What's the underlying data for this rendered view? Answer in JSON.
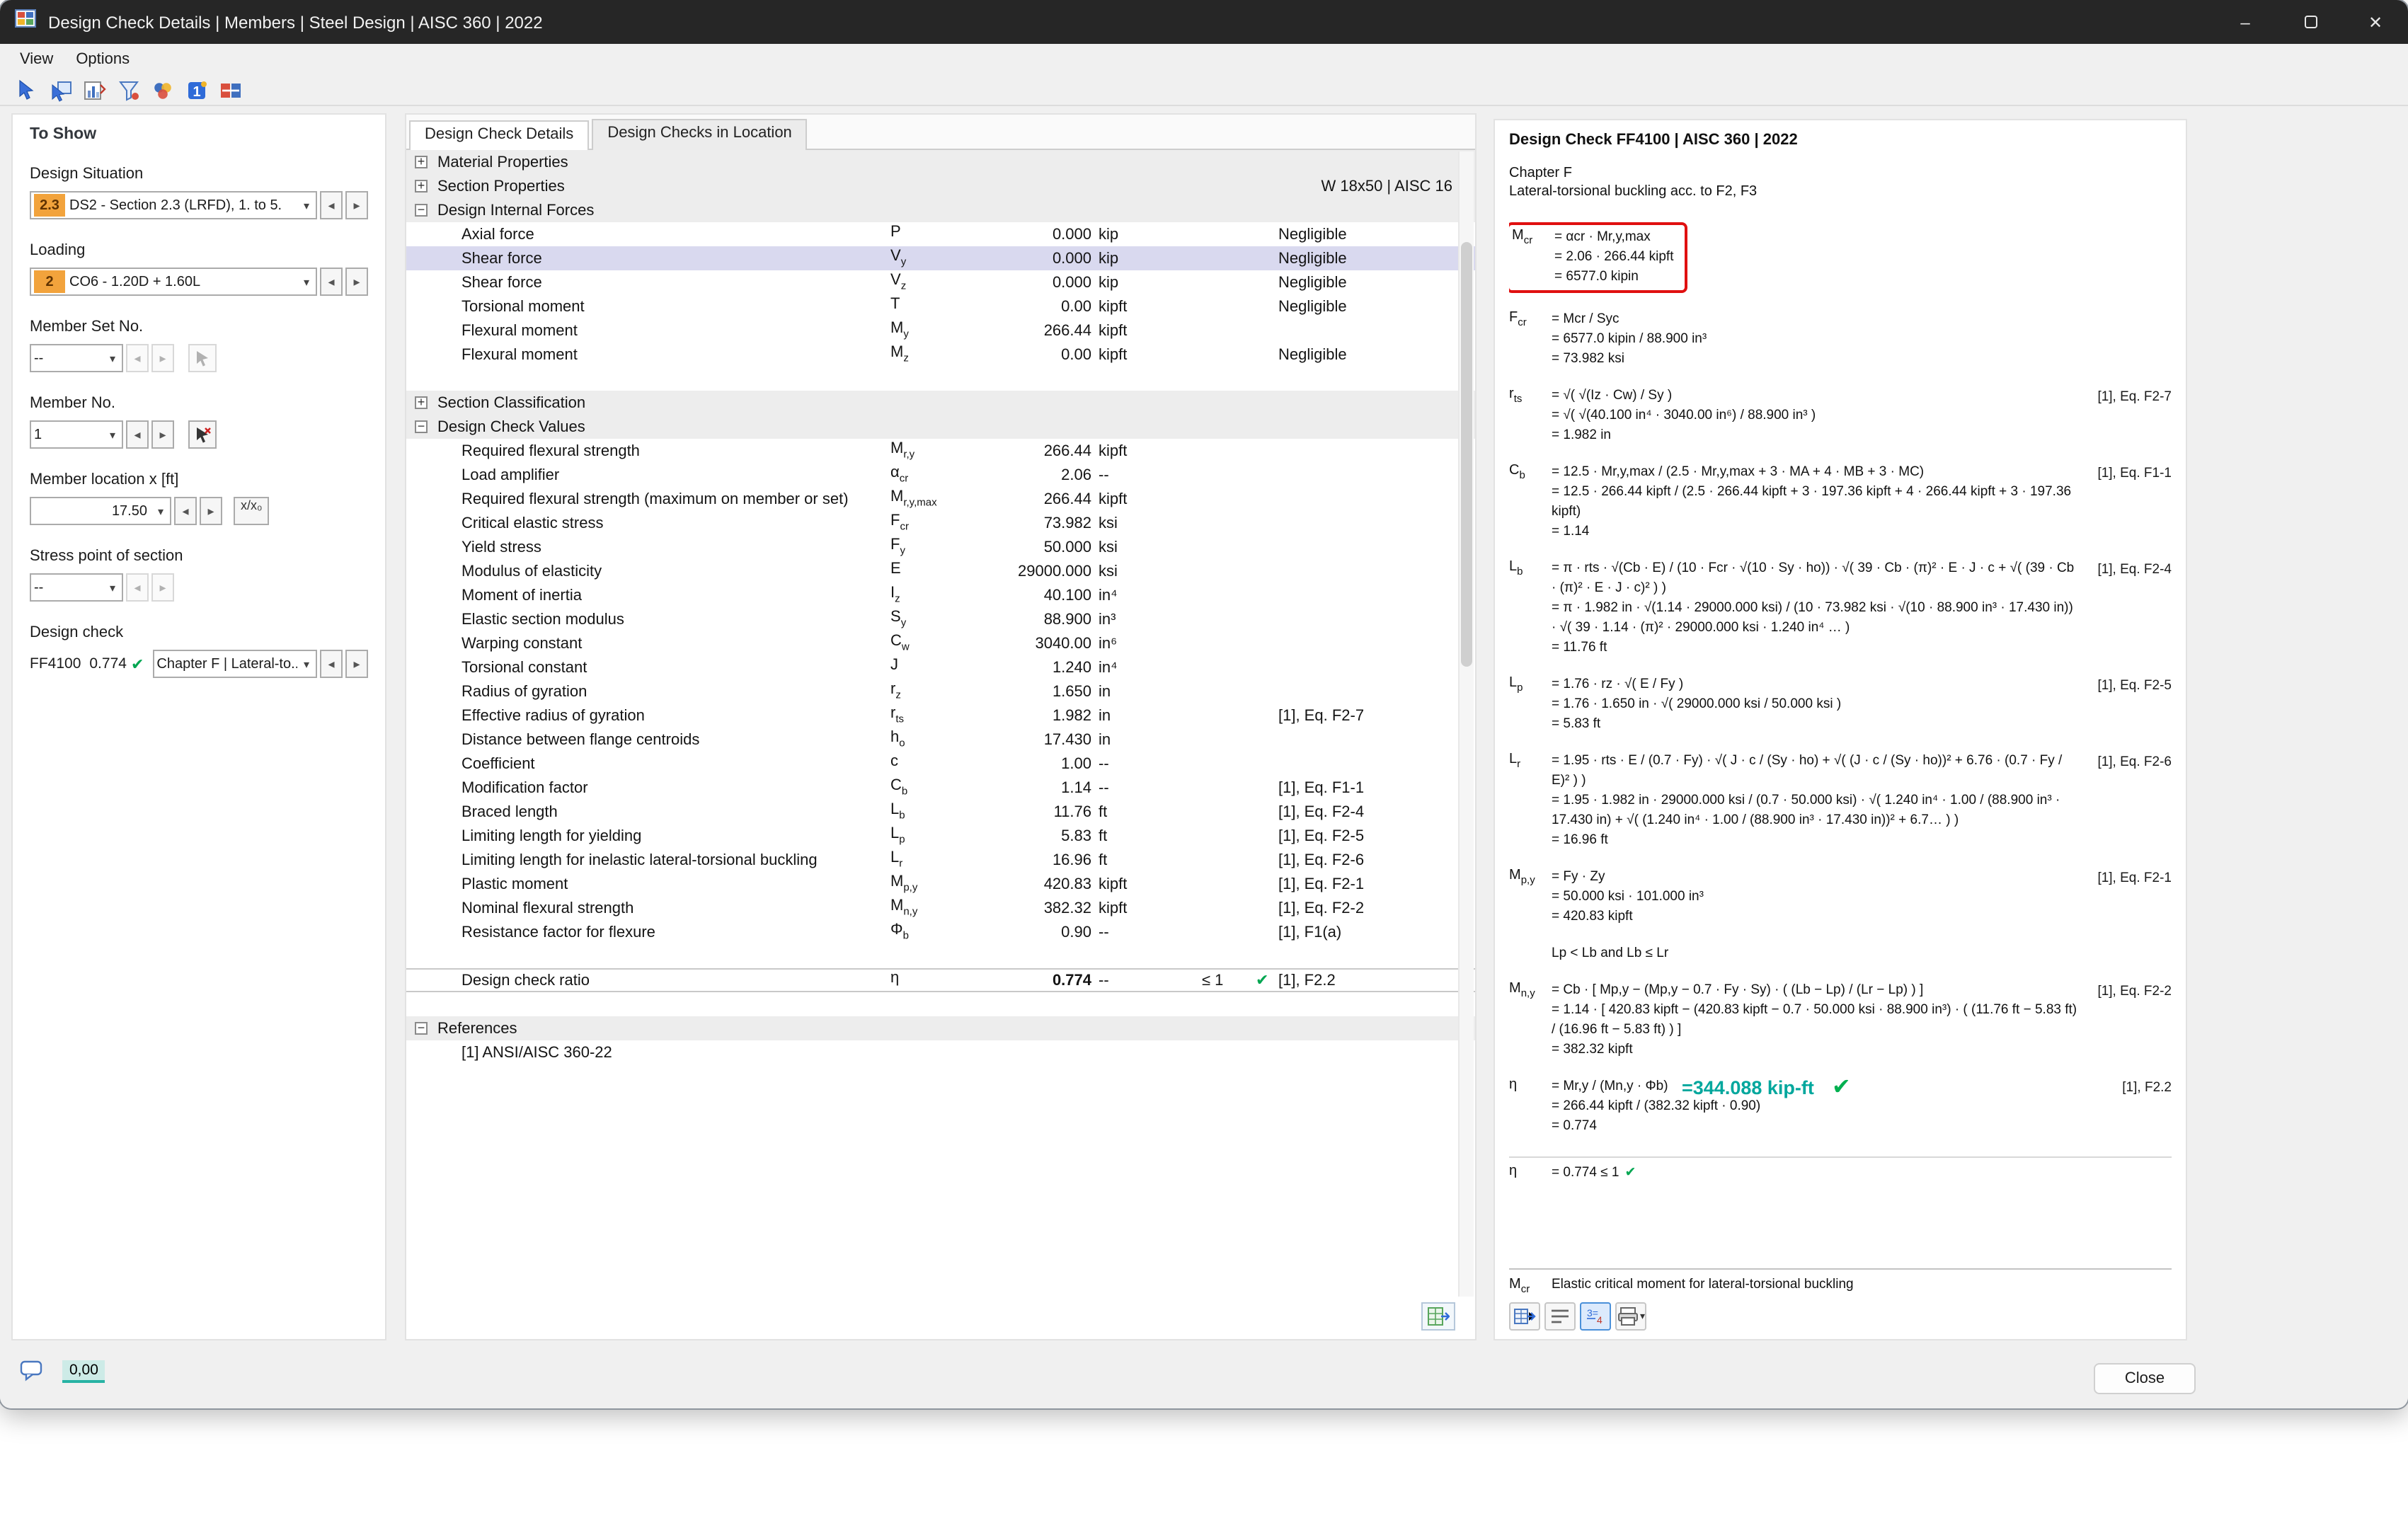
{
  "window": {
    "title": "Design Check Details | Members | Steel Design | AISC 360 | 2022",
    "minimize": "–",
    "close": "✕"
  },
  "menubar": {
    "view": "View",
    "options": "Options"
  },
  "icons": {
    "titlebar": [
      "app-icon",
      "minimize-icon",
      "maximize-icon",
      "close-icon"
    ],
    "toolbar": [
      "select-arrow-icon",
      "select-window-icon",
      "result-diagram-icon",
      "filter-icon",
      "color-scheme-icon",
      "object-info-icon",
      "units-icon"
    ],
    "right_toolbar": [
      "transfer-results-icon",
      "formula-list-icon",
      "show-values-icon",
      "print-icon"
    ],
    "misc": [
      "comment-bubble-icon",
      "send-to-table-icon",
      "pick-member-icon",
      "check-icon",
      "dropdown-caret-icon",
      "tree-expander-icon"
    ]
  },
  "colors": {
    "badge_orange": "#F2A33C",
    "row_highlight": "#D9D9EF",
    "check_green": "#00A651",
    "result_teal": "#00A79D",
    "error_red": "#E01010"
  },
  "to_show": {
    "title": "To Show",
    "design_situation_label": "Design Situation",
    "design_situation_badge": "2.3",
    "design_situation_value": "DS2 - Section 2.3 (LRFD), 1. to 5.",
    "loading_label": "Loading",
    "loading_badge": "2",
    "loading_value": "CO6 - 1.20D + 1.60L",
    "member_set_label": "Member Set No.",
    "member_set_value": "--",
    "member_no_label": "Member No.",
    "member_no_value": "1",
    "member_location_label": "Member location x [ft]",
    "member_location_value": "17.50",
    "xg_button": "x/x₀",
    "stress_point_label": "Stress point of section",
    "stress_point_value": "--",
    "design_check_label": "Design check",
    "design_check_id": "FF4100",
    "design_check_ratio": "0.774",
    "design_check_check": "✔",
    "design_check_value": "Chapter F | Lateral-to..."
  },
  "tabs": [
    {
      "label": "Design Check Details",
      "cls": "active"
    },
    {
      "label": "Design Checks in Location"
    }
  ],
  "table": {
    "rows": [
      {
        "type": "group",
        "expand": "+",
        "desc": "Material Properties"
      },
      {
        "type": "group",
        "expand": "+",
        "desc": "Section Properties",
        "extra": "W 18x50 | AISC 16"
      },
      {
        "type": "group",
        "expand": "−",
        "desc": "Design Internal Forces"
      },
      {
        "type": "item",
        "desc": "Axial force",
        "sym": "P",
        "val": "0.000",
        "unit": "kip",
        "ref": "Negligible"
      },
      {
        "type": "item hl",
        "desc": "Shear force",
        "sym": "V",
        "sub": "y",
        "val": "0.000",
        "unit": "kip",
        "ref": "Negligible"
      },
      {
        "type": "item",
        "desc": "Shear force",
        "sym": "V",
        "sub": "z",
        "val": "0.000",
        "unit": "kip",
        "ref": "Negligible"
      },
      {
        "type": "item",
        "desc": "Torsional moment",
        "sym": "T",
        "val": "0.00",
        "unit": "kipft",
        "ref": "Negligible"
      },
      {
        "type": "item",
        "desc": "Flexural moment",
        "sym": "M",
        "sub": "y",
        "val": "266.44",
        "unit": "kipft"
      },
      {
        "type": "item",
        "desc": "Flexural moment",
        "sym": "M",
        "sub": "z",
        "val": "0.00",
        "unit": "kipft",
        "ref": "Negligible"
      },
      {
        "type": "spacer"
      },
      {
        "type": "group",
        "expand": "+",
        "desc": "Section Classification"
      },
      {
        "type": "group",
        "expand": "−",
        "desc": "Design Check Values"
      },
      {
        "type": "item",
        "desc": "Required flexural strength",
        "sym": "M",
        "sub": "r,y",
        "val": "266.44",
        "unit": "kipft"
      },
      {
        "type": "item",
        "desc": "Load amplifier",
        "sym": "α",
        "sub": "cr",
        "val": "2.06",
        "unit": "--"
      },
      {
        "type": "item",
        "desc": "Required flexural strength (maximum on member or set)",
        "sym": "M",
        "sub": "r,y,max",
        "val": "266.44",
        "unit": "kipft"
      },
      {
        "type": "item",
        "desc": "Critical elastic stress",
        "sym": "F",
        "sub": "cr",
        "val": "73.982",
        "unit": "ksi"
      },
      {
        "type": "item",
        "desc": "Yield stress",
        "sym": "F",
        "sub": "y",
        "val": "50.000",
        "unit": "ksi"
      },
      {
        "type": "item",
        "desc": "Modulus of elasticity",
        "sym": "E",
        "val": "29000.000",
        "unit": "ksi"
      },
      {
        "type": "item",
        "desc": "Moment of inertia",
        "sym": "I",
        "sub": "z",
        "val": "40.100",
        "unit": "in⁴"
      },
      {
        "type": "item",
        "desc": "Elastic section modulus",
        "sym": "S",
        "sub": "y",
        "val": "88.900",
        "unit": "in³"
      },
      {
        "type": "item",
        "desc": "Warping constant",
        "sym": "C",
        "sub": "w",
        "val": "3040.00",
        "unit": "in⁶"
      },
      {
        "type": "item",
        "desc": "Torsional constant",
        "sym": "J",
        "val": "1.240",
        "unit": "in⁴"
      },
      {
        "type": "item",
        "desc": "Radius of gyration",
        "sym": "r",
        "sub": "z",
        "val": "1.650",
        "unit": "in"
      },
      {
        "type": "item",
        "desc": "Effective radius of gyration",
        "sym": "r",
        "sub": "ts",
        "val": "1.982",
        "unit": "in",
        "ref": "[1], Eq. F2-7"
      },
      {
        "type": "item",
        "desc": "Distance between flange centroids",
        "sym": "h",
        "sub": "o",
        "val": "17.430",
        "unit": "in"
      },
      {
        "type": "item",
        "desc": "Coefficient",
        "sym": "c",
        "val": "1.00",
        "unit": "--"
      },
      {
        "type": "item",
        "desc": "Modification factor",
        "sym": "C",
        "sub": "b",
        "val": "1.14",
        "unit": "--",
        "ref": "[1], Eq. F1-1"
      },
      {
        "type": "item",
        "desc": "Braced length",
        "sym": "L",
        "sub": "b",
        "val": "11.76",
        "unit": "ft",
        "ref": "[1], Eq. F2-4"
      },
      {
        "type": "item",
        "desc": "Limiting length for yielding",
        "sym": "L",
        "sub": "p",
        "val": "5.83",
        "unit": "ft",
        "ref": "[1], Eq. F2-5"
      },
      {
        "type": "item",
        "desc": "Limiting length for inelastic lateral-torsional buckling",
        "sym": "L",
        "sub": "r",
        "val": "16.96",
        "unit": "ft",
        "ref": "[1], Eq. F2-6"
      },
      {
        "type": "item",
        "desc": "Plastic moment",
        "sym": "M",
        "sub": "p,y",
        "val": "420.83",
        "unit": "kipft",
        "ref": "[1], Eq. F2-1"
      },
      {
        "type": "item",
        "desc": "Nominal flexural strength",
        "sym": "M",
        "sub": "n,y",
        "val": "382.32",
        "unit": "kipft",
        "ref": "[1], Eq. F2-2"
      },
      {
        "type": "item",
        "desc": "Resistance factor for flexure",
        "sym": "Φ",
        "sub": "b",
        "val": "0.90",
        "unit": "--",
        "ref": "[1], F1(a)"
      },
      {
        "type": "spacer"
      },
      {
        "type": "item result",
        "desc": "Design check ratio",
        "sym": "η",
        "val": "0.774",
        "unit": "--",
        "crit": "≤ 1",
        "check": "✔",
        "ref": "[1], F2.2"
      },
      {
        "type": "spacer"
      },
      {
        "type": "group",
        "expand": "−",
        "desc": "References"
      },
      {
        "type": "item",
        "desc": "[1]  ANSI/AISC 360-22"
      }
    ]
  },
  "right_panel": {
    "title": "Design Check FF4100 | AISC 360 | 2022",
    "chapter": "Chapter F",
    "subtitle": "Lateral-torsional buckling acc. to F2, F3",
    "blocks": [
      {
        "cls": "hl",
        "sym": "M",
        "sub": "cr",
        "lines": [
          {
            "t": "=  αcr · Mr,y,max"
          },
          {
            "t": "=  2.06 · 266.44 kipft"
          },
          {
            "t": "=  6577.0 kipin"
          }
        ]
      },
      {
        "sym": "F",
        "sub": "cr",
        "lines": [
          {
            "t": "=  Mcr / Syc"
          },
          {
            "t": "=  6577.0 kipin / 88.900 in³"
          },
          {
            "t": "=  73.982 ksi"
          }
        ]
      },
      {
        "sym": "r",
        "sub": "ts",
        "ref": "[1], Eq. F2-7",
        "lines": [
          {
            "t": "=  √( √(Iz · Cw) / Sy )"
          },
          {
            "t": "=  √( √(40.100 in⁴ · 3040.00 in⁶) / 88.900 in³ )"
          },
          {
            "t": "=  1.982 in"
          }
        ]
      },
      {
        "sym": "C",
        "sub": "b",
        "ref": "[1], Eq. F1-1",
        "lines": [
          {
            "t": "=  12.5 · Mr,y,max / (2.5 · Mr,y,max + 3 · MA + 4 · MB + 3 · MC)"
          },
          {
            "t": "=  12.5 · 266.44 kipft / (2.5 · 266.44 kipft + 3 · 197.36 kipft + 4 · 266.44 kipft + 3 · 197.36 kipft)"
          },
          {
            "t": "=  1.14"
          }
        ]
      },
      {
        "sym": "L",
        "sub": "b",
        "ref": "[1], Eq. F2-4",
        "lines": [
          {
            "t": "=  π · rts · √(Cb · E) / (10 · Fcr · √(10 · Sy · ho)) · √( 39 · Cb · (π)² · E · J · c + √( (39 · Cb · (π)² · E · J · c)² ) )"
          },
          {
            "t": "=  π · 1.982 in · √(1.14 · 29000.000 ksi) / (10 · 73.982 ksi · √(10 · 88.900 in³ · 17.430 in)) · √( 39 · 1.14 · (π)² · 29000.000 ksi · 1.240 in⁴ … )"
          },
          {
            "t": "=  11.76 ft"
          }
        ]
      },
      {
        "sym": "L",
        "sub": "p",
        "ref": "[1], Eq. F2-5",
        "lines": [
          {
            "t": "=  1.76 · rz · √( E / Fy )"
          },
          {
            "t": "=  1.76 · 1.650 in · √( 29000.000 ksi / 50.000 ksi )"
          },
          {
            "t": "=  5.83 ft"
          }
        ]
      },
      {
        "sym": "L",
        "sub": "r",
        "ref": "[1], Eq. F2-6",
        "lines": [
          {
            "t": "=  1.95 · rts · E / (0.7 · Fy) · √( J · c / (Sy · ho) + √( (J · c / (Sy · ho))² + 6.76 · (0.7 · Fy / E)² ) )"
          },
          {
            "t": "=  1.95 · 1.982 in · 29000.000 ksi / (0.7 · 50.000 ksi) · √( 1.240 in⁴ · 1.00 / (88.900 in³ · 17.430 in) + √( (1.240 in⁴ · 1.00 / (88.900 in³ · 17.430 in))² + 6.7… ) )"
          },
          {
            "t": "=  16.96 ft"
          }
        ]
      },
      {
        "sym": "M",
        "sub": "p,y",
        "ref": "[1], Eq. F2-1",
        "lines": [
          {
            "t": "=  Fy · Zy"
          },
          {
            "t": "=  50.000 ksi · 101.000 in³"
          },
          {
            "t": "=  420.83 kipft"
          }
        ]
      },
      {
        "cond": "Lp < Lb and Lb ≤ Lr"
      },
      {
        "sym": "M",
        "sub": "n,y",
        "ref": "[1], Eq. F2-2",
        "lines": [
          {
            "t": "=  Cb · [ Mp,y − (Mp,y − 0.7 · Fy · Sy) · ( (Lb − Lp) / (Lr − Lp) ) ]"
          },
          {
            "t": "=  1.14 · [ 420.83 kipft − (420.83 kipft − 0.7 · 50.000 ksi · 88.900 in³) · ( (11.76 ft − 5.83 ft) / (16.96 ft − 5.83 ft) ) ]"
          },
          {
            "t": "=  382.32 kipft"
          }
        ]
      },
      {
        "sym": "η",
        "ref": "[1], F2.2",
        "teal": "=344.088 kip-ft",
        "teal_check": "✔",
        "lines": [
          {
            "t": "=  Mr,y / (Mn,y · Φb)"
          },
          {
            "t": "=  266.44 kipft / (382.32 kipft · 0.90)"
          },
          {
            "t": "=  0.774"
          }
        ]
      },
      {
        "cls": "final",
        "sym": "η",
        "lines": [
          {
            "t": "=  0.774  ≤ 1",
            "c": "✔"
          }
        ]
      }
    ],
    "footer_sym": "M",
    "footer_sub": "cr",
    "footer_text": "Elastic critical moment for lateral-torsional buckling"
  },
  "statusbar": {
    "value": "0,00"
  },
  "close_button": "Close"
}
